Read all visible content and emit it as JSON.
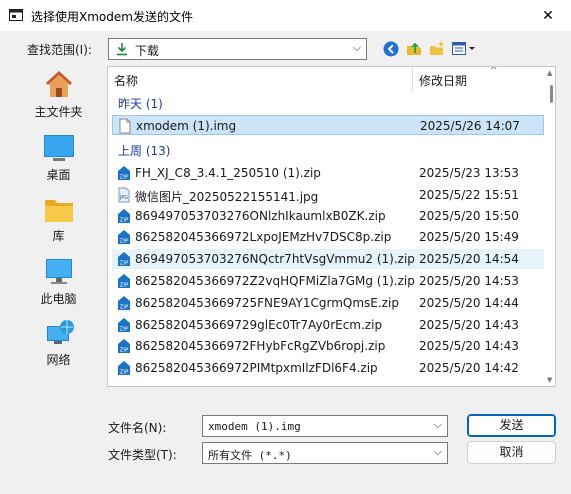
{
  "window": {
    "title": "选择使用Xmodem发送的文件",
    "close_glyph": "✕"
  },
  "lookin": {
    "label": "查找范围(I):",
    "value": "下载",
    "arrow": "⌵"
  },
  "places": [
    {
      "label": "主文件夹",
      "icon": "home-icon"
    },
    {
      "label": "桌面",
      "icon": "desktop-icon"
    },
    {
      "label": "库",
      "icon": "library-folder-icon"
    },
    {
      "label": "此电脑",
      "icon": "computer-icon"
    },
    {
      "label": "网络",
      "icon": "network-icon"
    }
  ],
  "list": {
    "col_name": "名称",
    "col_date": "修改日期",
    "sort_glyph": "^",
    "groups": [
      {
        "label": "昨天 (1)"
      },
      {
        "label": "上周 (13)"
      }
    ],
    "files": [
      {
        "name": "xmodem (1).img",
        "date": "2025/5/26 14:07",
        "icon": "img-file-icon"
      },
      {
        "name": "FH_XJ_C8_3.4.1_250510 (1).zip",
        "date": "2025/5/23 13:53",
        "icon": "zip-file-icon"
      },
      {
        "name": "微信图片_20250522155141.jpg",
        "date": "2025/5/22 15:51",
        "icon": "jpg-file-icon"
      },
      {
        "name": "869497053703276ONlzhIkaumlxB0ZK.zip",
        "date": "2025/5/20 15:50",
        "icon": "zip-file-icon"
      },
      {
        "name": "862582045366972LxpoJEMzHv7DSC8p.zip",
        "date": "2025/5/20 15:49",
        "icon": "zip-file-icon"
      },
      {
        "name": "869497053703276NQctr7htVsgVmmu2 (1).zip",
        "date": "2025/5/20 14:54",
        "icon": "zip-file-icon"
      },
      {
        "name": "862582045366972Z2vqHQFMiZla7GMg (1).zip",
        "date": "2025/5/20 14:53",
        "icon": "zip-file-icon"
      },
      {
        "name": "8625820453669725FNE9AY1CgrmQmsE.zip",
        "date": "2025/5/20 14:44",
        "icon": "zip-file-icon"
      },
      {
        "name": "8625820453669729glEc0Tr7Ay0rEcm.zip",
        "date": "2025/5/20 14:43",
        "icon": "zip-file-icon"
      },
      {
        "name": "862582045366972FHybFcRgZVb6ropj.zip",
        "date": "2025/5/20 14:43",
        "icon": "zip-file-icon"
      },
      {
        "name": "862582045366972PIMtpxmIlzFDl6F4.zip",
        "date": "2025/5/20 14:42",
        "icon": "zip-file-icon"
      }
    ]
  },
  "filename": {
    "label": "文件名(N):",
    "value": "xmodem (1).img",
    "arrow": "⌵"
  },
  "filetype": {
    "label": "文件类型(T):",
    "value": "所有文件 (*.*)",
    "arrow": "⌵"
  },
  "buttons": {
    "send": "发送",
    "cancel": "取消"
  },
  "colors": {
    "accent": "#0067c0",
    "selection": "#cce4f7",
    "group_text": "#1e3aa0"
  }
}
